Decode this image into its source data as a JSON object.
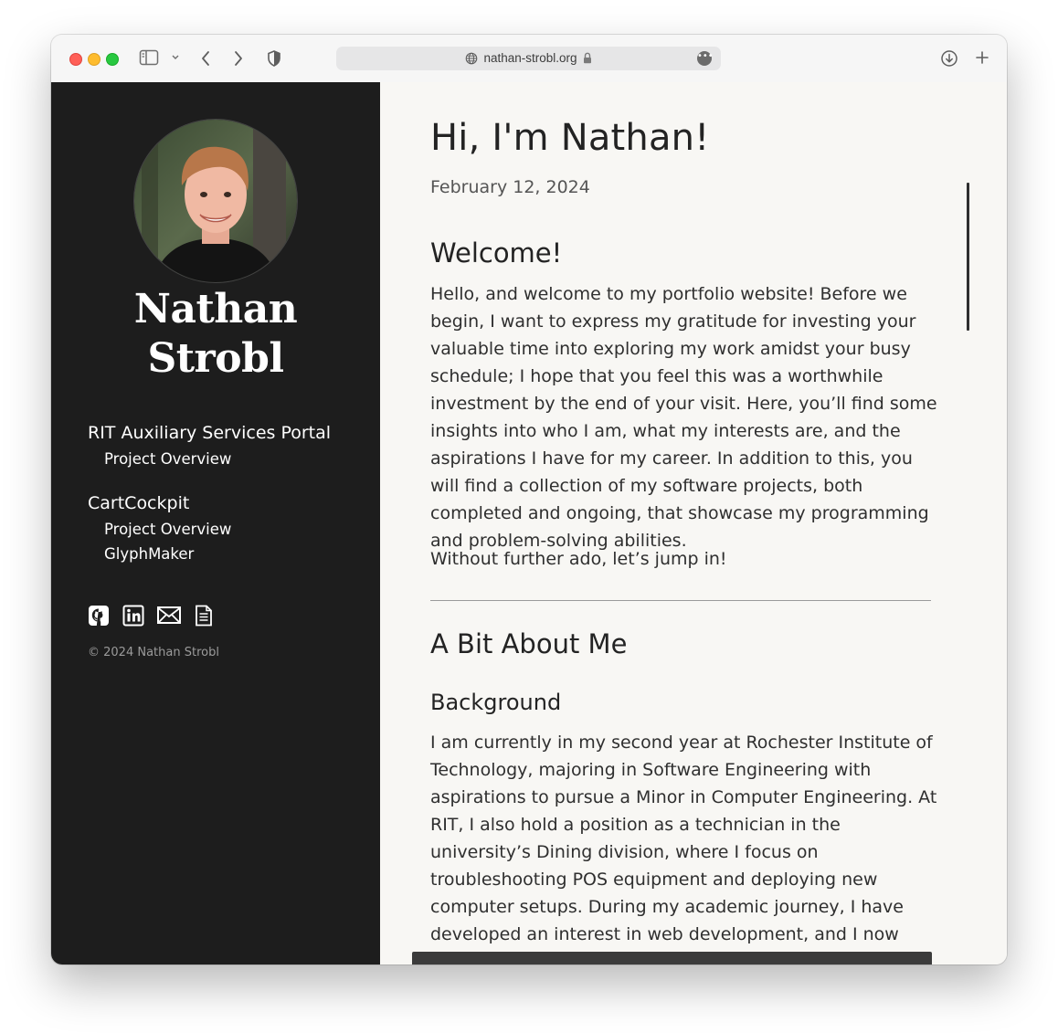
{
  "browser": {
    "url": "nathan-strobl.org",
    "icons": [
      "sidebar-toggle-icon",
      "chevron-down-icon",
      "back-icon",
      "forward-icon",
      "privacy-shield-icon",
      "globe-icon",
      "lock-icon",
      "more-icon",
      "download-icon",
      "new-tab-icon"
    ]
  },
  "sidebar": {
    "name_line1": "Nathan",
    "name_line2": "Strobl",
    "avatar_alt": "profile-photo",
    "nav": [
      {
        "title": "RIT Auxiliary Services Portal",
        "items": [
          "Project Overview"
        ]
      },
      {
        "title": "CartCockpit",
        "items": [
          "Project Overview",
          "GlyphMaker"
        ]
      }
    ],
    "social_icons": [
      "github-icon",
      "linkedin-icon",
      "email-icon",
      "resume-icon"
    ],
    "copyright": "© 2024 Nathan Strobl"
  },
  "content": {
    "title": "Hi, I'm Nathan!",
    "date": "February 12, 2024",
    "welcome_heading": "Welcome!",
    "welcome_para1": "Hello, and welcome to my portfolio website! Before we begin, I want to express my gratitude for investing your valuable time into exploring my work amidst your busy schedule; I hope that you feel this was a worthwhile investment by the end of your visit. Here, you’ll find some insights into who I am, what my interests are, and the aspirations I have for my career. In addition to this, you will find a collection of my software projects, both completed and ongoing, that showcase my programming and problem-solving abilities.",
    "welcome_para2": "Without further ado, let’s jump in!",
    "about_heading": "A Bit About Me",
    "background_heading": "Background",
    "background_para": "I am currently in my second year at Rochester Institute of Technology, majoring in Software Engineering with aspirations to pursue a Minor in Computer Engineering. At RIT, I also hold a position as a technician in the university’s Dining division, where I focus on troubleshooting POS equipment and deploying new computer setups. During my academic journey, I have developed an interest in web development, and I now dedicate a significant portion of my"
  },
  "colors": {
    "sidebar_bg": "#1d1d1d",
    "content_bg": "#f8f7f4",
    "text": "#2f2f2f"
  }
}
